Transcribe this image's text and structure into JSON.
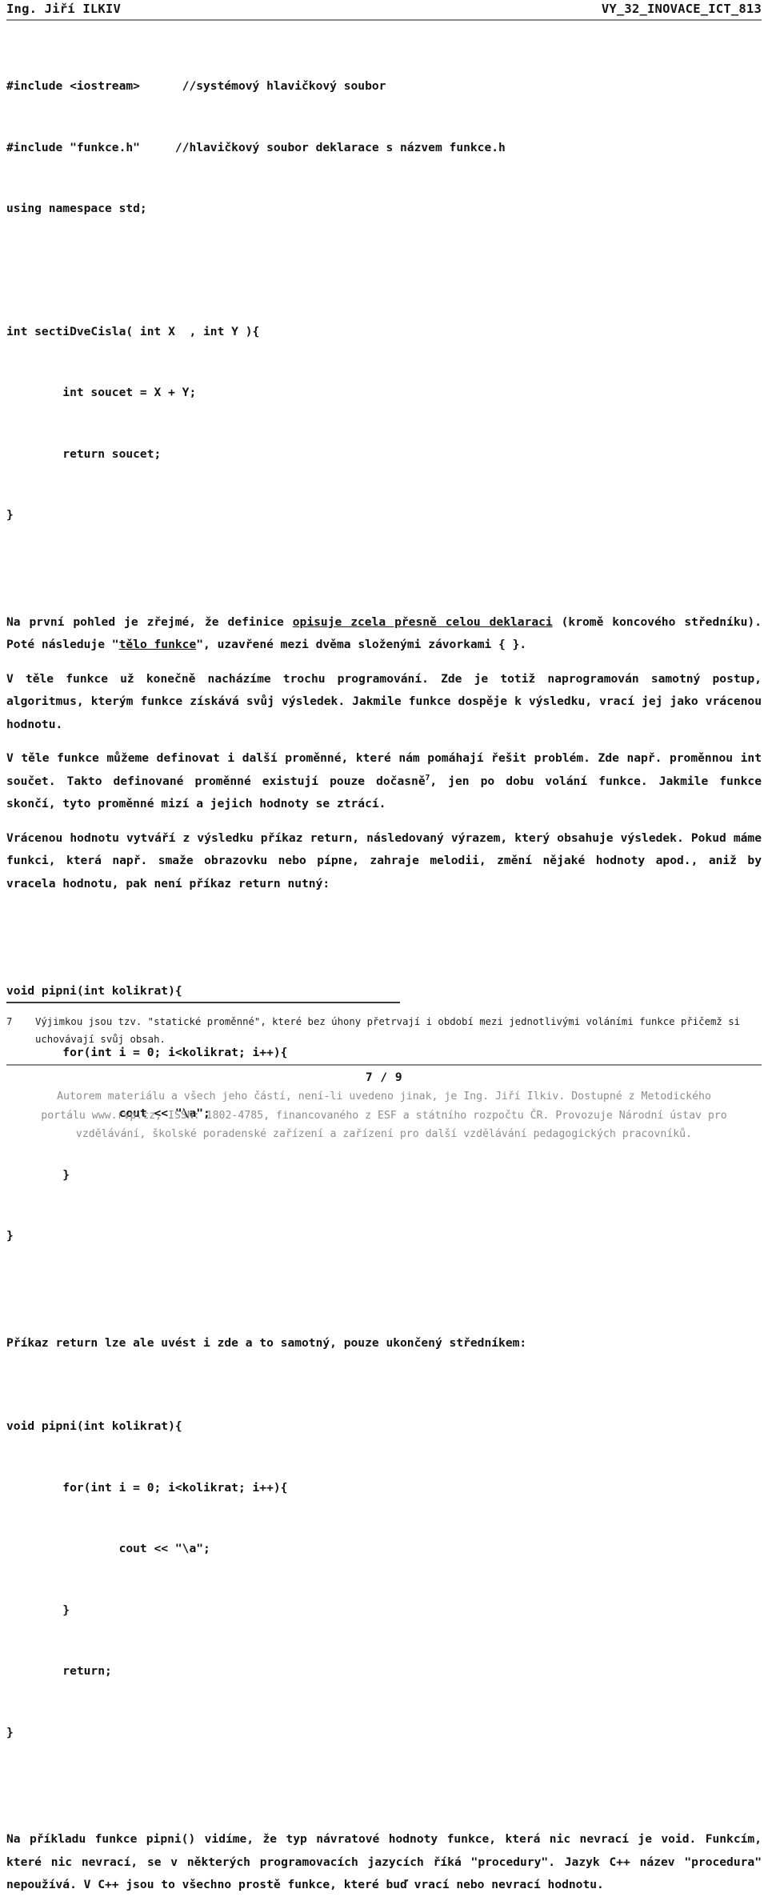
{
  "header": {
    "author": "Ing. Jiří ILKIV",
    "doc_code": "VY_32_INOVACE_ICT_813"
  },
  "code_block_1": {
    "lines": [
      "#include <iostream>      //systémový hlavičkový soubor",
      "#include \"funkce.h\"     //hlavičkový soubor deklarace s názvem funkce.h",
      "using namespace std;"
    ]
  },
  "code_block_2": {
    "lines": [
      "int sectiDveCisla( int X  , int Y ){",
      "        int soucet = X + Y;",
      "        return soucet;",
      "}"
    ]
  },
  "paragraphs": {
    "p1_a": "Na první pohled je zřejmé, že definice ",
    "p1_u1": "opisuje zcela přesně celou deklaraci",
    "p1_b": " (kromě koncového středníku). Poté následuje \"",
    "p1_u2": "tělo funkce",
    "p1_c": "\", uzavřené  mezi dvěma složenými závorkami { }.",
    "p2": "V těle funkce už konečně nacházíme trochu programování. Zde je totiž naprogramován samotný postup, algoritmus, kterým funkce získává svůj výsledek. Jakmile funkce dospěje k výsledku, vrací jej jako vrácenou hodnotu.",
    "p3_a": "V těle funkce můžeme definovat i další proměnné, které nám pomáhají řešit problém. Zde např. proměnnou  int součet. Takto definované proměnné existují pouze dočasně",
    "p3_sup": "7",
    "p3_b": ", jen po dobu volání funkce. Jakmile funkce skončí, tyto proměnné mizí a jejich hodnoty se ztrácí.",
    "p4": "Vrácenou hodnotu vytváří z výsledku příkaz return, následovaný výrazem, který obsahuje výsledek. Pokud máme funkci, která např. smaže obrazovku nebo pípne, zahraje melodii, změní nějaké hodnoty apod., aniž by vracela hodnotu, pak není příkaz return nutný:",
    "p5": "Příkaz return lze ale uvést i zde a to samotný, pouze ukončený středníkem:",
    "p6": "Na příkladu funkce pipni() vidíme, že typ návratové hodnoty funkce, která nic nevrací je void. Funkcím, které nic nevrací, se v některých programovacích jazycích říká \"procedury\". Jazyk C++ název \"procedura\" nepoužívá. V C++ jsou to všechno prostě funkce, které buď vrací nebo nevrací hodnotu."
  },
  "code_block_3": {
    "lines": [
      "void pipni(int kolikrat){",
      "        for(int i = 0; i<kolikrat; i++){",
      "                cout << \"\\a\";",
      "        }",
      "}"
    ]
  },
  "code_block_4": {
    "lines": [
      "void pipni(int kolikrat){",
      "        for(int i = 0; i<kolikrat; i++){",
      "                cout << \"\\a\";",
      "        }",
      "        return;",
      "}"
    ]
  },
  "footnote": {
    "number": "7",
    "text": "Výjimkou jsou tzv. \"statické proměnné\", které bez úhony přetrvají i období mezi jednotlivými voláními funkce přičemž si uchovávají svůj obsah."
  },
  "footer": {
    "page_number": "7 / 9",
    "line1": "Autorem materiálu a všech jeho částí, není-li uvedeno jinak, je Ing. Jiří Ilkiv. Dostupné z Metodického",
    "line2": "portálu www.rvp.cz, ISSN: 1802-4785, financovaného z ESF a státního rozpočtu ČR. Provozuje Národní ústav pro",
    "line3": "vzdělávání, školské poradenské zařízení a zařízení pro další vzdělávání pedagogických pracovníků."
  },
  "colors": {
    "text": "#141414",
    "rule": "#8a8a8a",
    "footer_text": "#8d8d8d"
  }
}
